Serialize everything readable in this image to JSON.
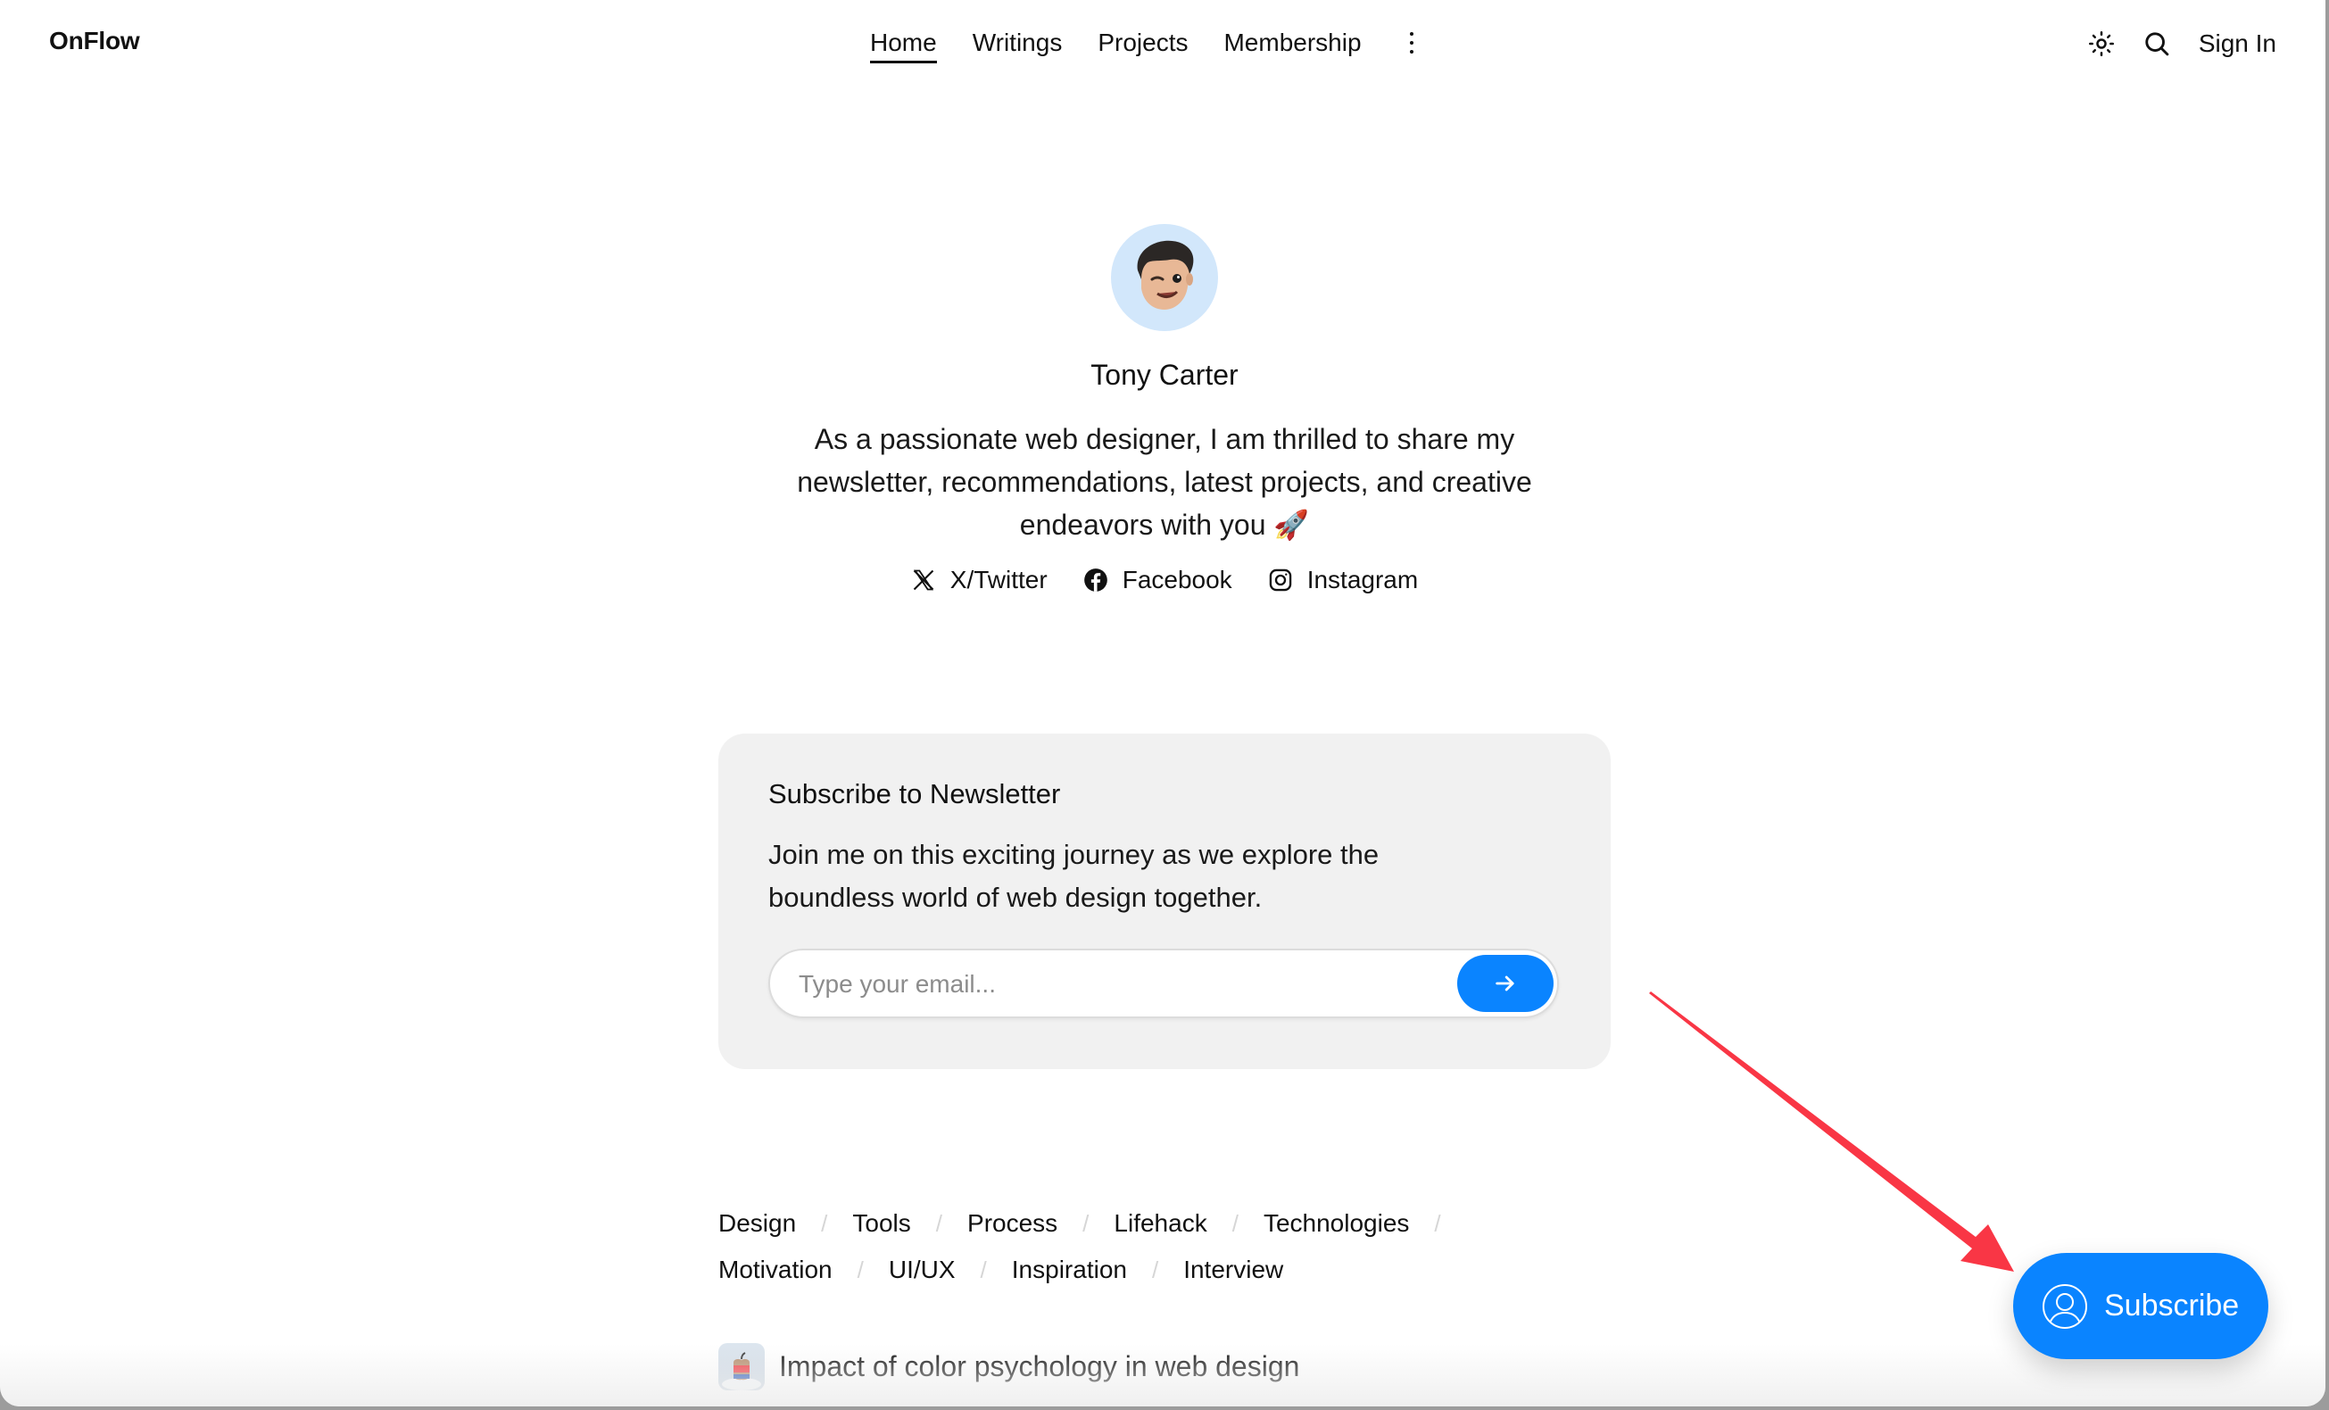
{
  "header": {
    "logo": "OnFlow",
    "nav": [
      {
        "label": "Home",
        "active": true
      },
      {
        "label": "Writings",
        "active": false
      },
      {
        "label": "Projects",
        "active": false
      },
      {
        "label": "Membership",
        "active": false
      }
    ],
    "more_icon": "vertical-ellipsis-icon",
    "theme_icon": "sun-icon",
    "search_icon": "search-icon",
    "sign_in": "Sign In"
  },
  "profile": {
    "avatar_icon": "memoji-avatar",
    "name": "Tony Carter",
    "bio": "As a passionate web designer, I am thrilled to share my newsletter, recommendations, latest projects, and creative endeavors with you 🚀",
    "socials": [
      {
        "label": "X/Twitter",
        "icon": "x-twitter-icon"
      },
      {
        "label": "Facebook",
        "icon": "facebook-icon"
      },
      {
        "label": "Instagram",
        "icon": "instagram-icon"
      }
    ]
  },
  "newsletter": {
    "title": "Subscribe to Newsletter",
    "body": "Join me on this exciting journey as we explore the boundless world of web design together.",
    "email_placeholder": "Type your email...",
    "email_value": "",
    "submit_icon": "arrow-right-icon"
  },
  "categories": {
    "rows": [
      [
        "Design",
        "Tools",
        "Process",
        "Lifehack",
        "Technologies"
      ],
      [
        "Motivation",
        "UI/UX",
        "Inspiration",
        "Interview"
      ]
    ],
    "separator": "/"
  },
  "articles": [
    {
      "title": "Impact of color psychology in web design",
      "icon": "apple-snowglobe-thumbnail"
    }
  ],
  "floating_subscribe": {
    "label": "Subscribe",
    "icon": "user-circle-icon",
    "color": "#0a84ff"
  },
  "annotation": {
    "type": "arrow",
    "color": "#f93645",
    "points_to": "floating-subscribe-button"
  },
  "colors": {
    "accent": "#0a84ff",
    "card_bg": "#f1f1f1",
    "avatar_bg": "#d2e7fb"
  }
}
